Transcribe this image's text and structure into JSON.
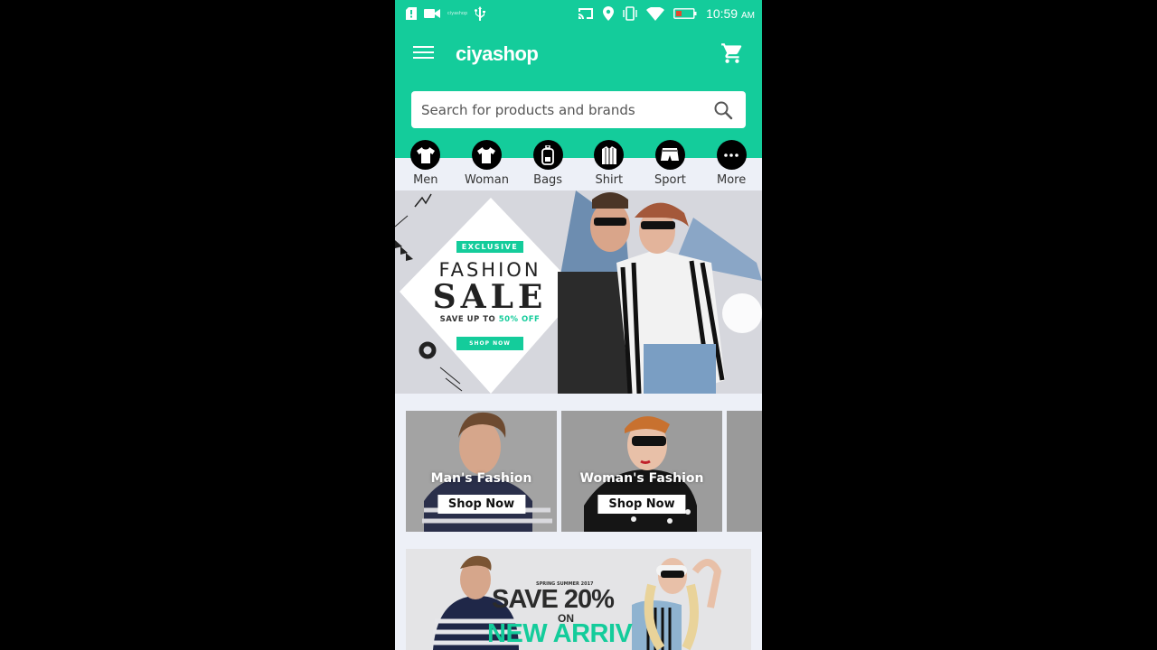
{
  "status_bar": {
    "time": "10:59",
    "time_suffix": "AM",
    "notification_text": "ciyashop"
  },
  "app_bar": {
    "logo": "ciyashop",
    "brand_color": "#14cc9b"
  },
  "search": {
    "placeholder": "Search for products and brands"
  },
  "categories": [
    {
      "label": "Men",
      "icon": "tshirt-icon"
    },
    {
      "label": "Woman",
      "icon": "tshirt-icon"
    },
    {
      "label": "Bags",
      "icon": "backpack-icon"
    },
    {
      "label": "Shirt",
      "icon": "shirt-icon"
    },
    {
      "label": "Sport",
      "icon": "shorts-icon"
    },
    {
      "label": "More",
      "icon": "more-icon"
    }
  ],
  "hero": {
    "badge": "EXCLUSIVE",
    "line1": "FASHION",
    "line2": "SALE",
    "save_prefix": "SAVE UP TO",
    "save_highlight": "50% OFF",
    "button": "SHOP NOW"
  },
  "fashion_banners": [
    {
      "title": "Man's Fashion",
      "button": "Shop Now"
    },
    {
      "title": "Woman's Fashion",
      "button": "Shop Now"
    }
  ],
  "promo": {
    "kicker": "SPRING SUMMER 2017",
    "headline": "SAVE 20%",
    "on": "ON",
    "highlight": "NEW ARRIV"
  }
}
